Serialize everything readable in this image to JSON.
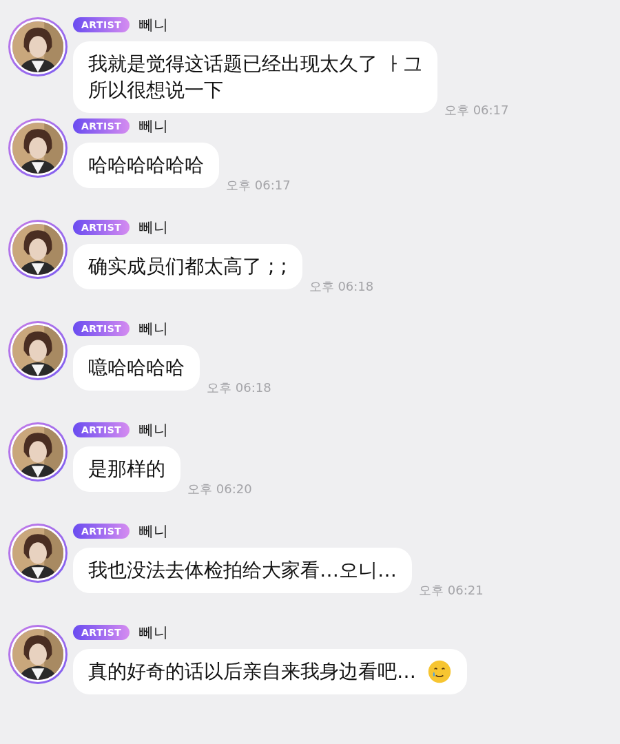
{
  "messages": [
    {
      "badge": "ARTIST",
      "name": "뻬니",
      "lines": [
        "我就是觉得这话题已经出现太久了 ㅏ그",
        "所以很想说一下"
      ],
      "time": "오후 06:17"
    },
    {
      "badge": "ARTIST",
      "name": "뻬니",
      "lines": [
        "哈哈哈哈哈哈"
      ],
      "time": "오후 06:17"
    },
    {
      "badge": "ARTIST",
      "name": "뻬니",
      "lines": [
        "确实成员们都太高了 ; ;"
      ],
      "time": "오후 06:18"
    },
    {
      "badge": "ARTIST",
      "name": "뻬니",
      "lines": [
        "噫哈哈哈哈"
      ],
      "time": "오후 06:18"
    },
    {
      "badge": "ARTIST",
      "name": "뻬니",
      "lines": [
        "是那样的"
      ],
      "time": "오후 06:20"
    },
    {
      "badge": "ARTIST",
      "name": "뻬니",
      "lines": [
        "我也没法去体检拍给大家看…오니…"
      ],
      "time": "오후 06:21"
    },
    {
      "badge": "ARTIST",
      "name": "뻬니",
      "lines": [
        "真的好奇的话以后亲自来我身边看吧…"
      ],
      "emoji": true
    }
  ]
}
